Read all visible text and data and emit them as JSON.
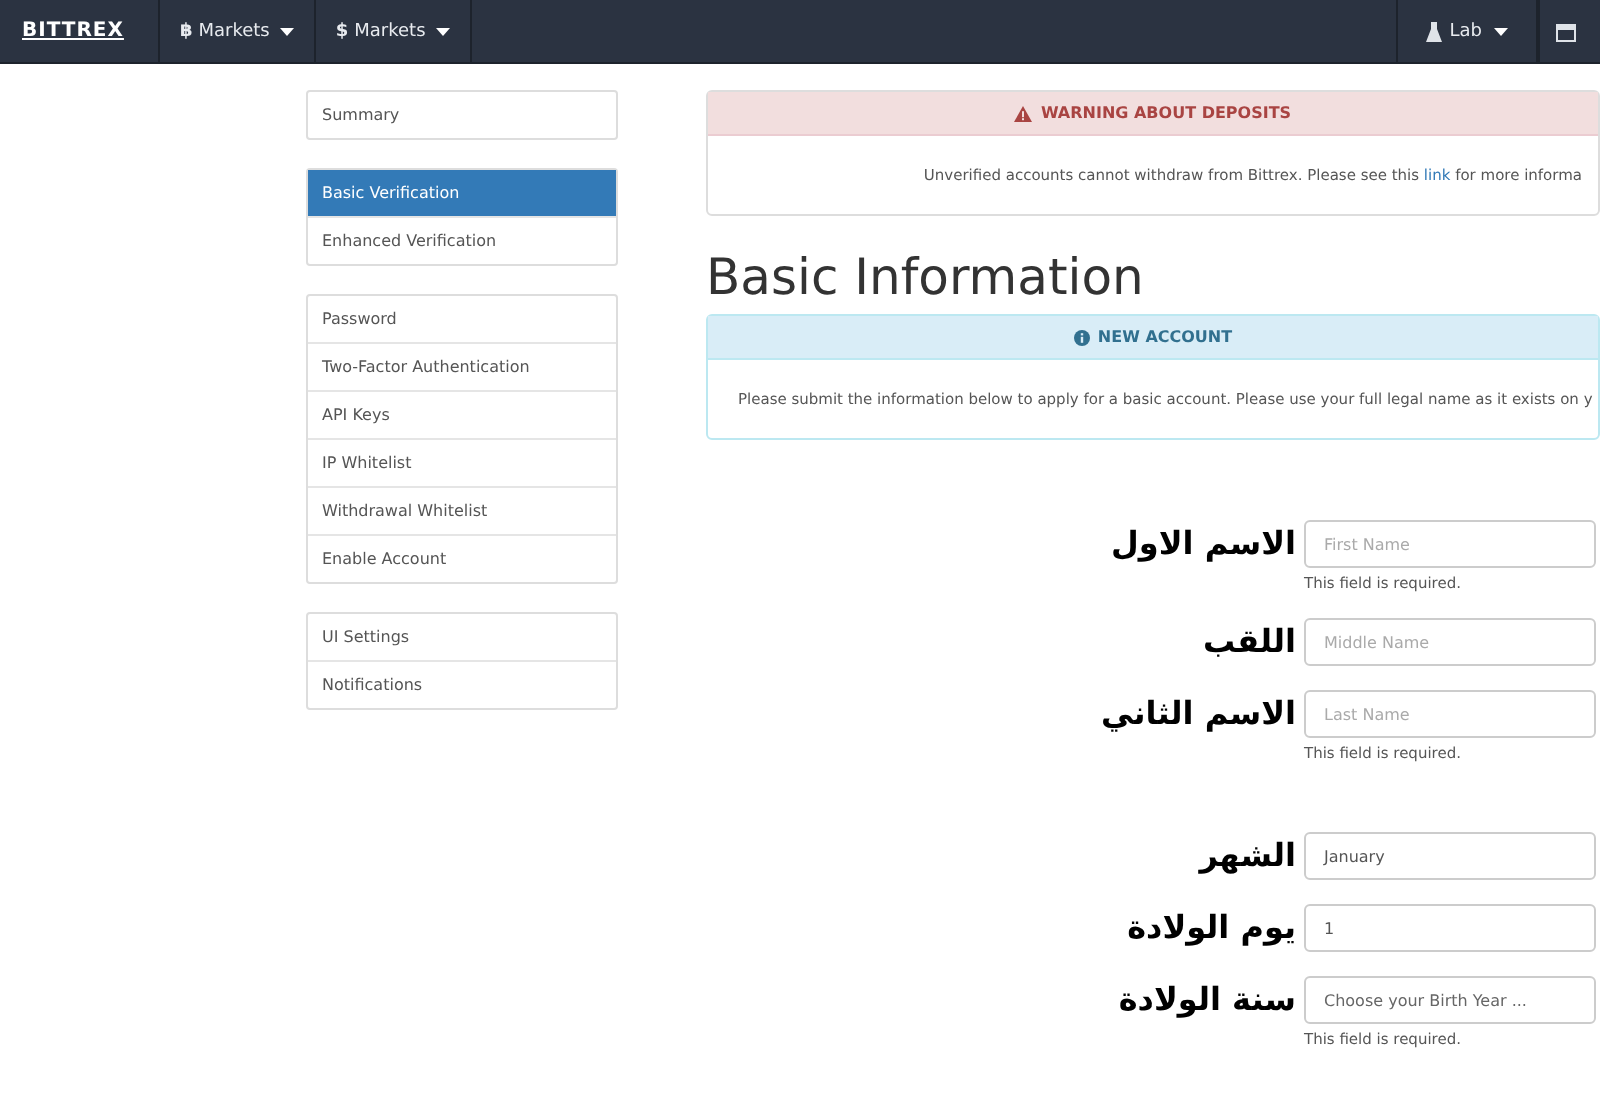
{
  "navbar": {
    "brand": "BITTREX",
    "menus": [
      {
        "glyph": "฿",
        "label": "Markets"
      },
      {
        "glyph": "$",
        "label": "Markets"
      }
    ],
    "user_menu": {
      "label": "Lab"
    }
  },
  "sidebar": {
    "groups": [
      [
        {
          "label": "Summary",
          "selected": false
        }
      ],
      [
        {
          "label": "Basic Verification",
          "selected": true
        },
        {
          "label": "Enhanced Verification",
          "selected": false
        }
      ],
      [
        {
          "label": "Password",
          "selected": false
        },
        {
          "label": "Two-Factor Authentication",
          "selected": false
        },
        {
          "label": "API Keys",
          "selected": false
        },
        {
          "label": "IP Whitelist",
          "selected": false
        },
        {
          "label": "Withdrawal Whitelist",
          "selected": false
        },
        {
          "label": "Enable Account",
          "selected": false
        }
      ],
      [
        {
          "label": "UI Settings",
          "selected": false
        },
        {
          "label": "Notifications",
          "selected": false
        }
      ]
    ]
  },
  "warning": {
    "title": "WARNING ABOUT DEPOSITS",
    "text_before": "Unverified accounts cannot withdraw from Bittrex. Please see this ",
    "link": "link",
    "text_after": " for more informa"
  },
  "heading": "Basic Information",
  "info": {
    "title": "NEW ACCOUNT",
    "text": "Please submit the information below to apply for a basic account. Please use your full legal name as it exists on y"
  },
  "form": {
    "groups": [
      [
        {
          "label": "الاسم الاول",
          "kind": "text",
          "placeholder": "First Name",
          "helper": "This field is required."
        },
        {
          "label": "اللقب",
          "kind": "text",
          "placeholder": "Middle Name"
        },
        {
          "label": "الاسم الثاني",
          "kind": "text",
          "placeholder": "Last Name",
          "helper": "This field is required."
        }
      ],
      [
        {
          "label": "الشهر",
          "kind": "select",
          "value": "January"
        },
        {
          "label": "يوم الولادة",
          "kind": "select",
          "value": "1"
        },
        {
          "label": "سنة الولادة",
          "kind": "select",
          "placeholder": "Choose your Birth Year ...",
          "helper": "This field is required."
        }
      ]
    ]
  }
}
